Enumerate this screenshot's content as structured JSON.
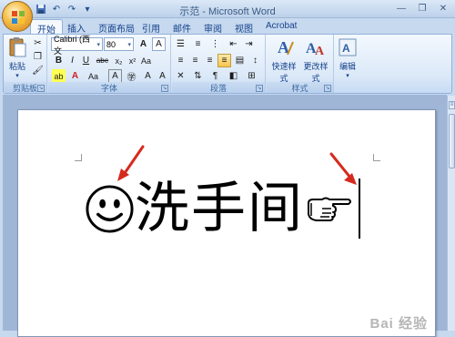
{
  "window": {
    "title": "示范 - Microsoft Word",
    "controls": [
      "minimize-icon",
      "maximize-icon",
      "close-icon"
    ]
  },
  "quick_access": [
    "save-icon",
    "undo-icon",
    "redo-icon",
    "dropdown-icon"
  ],
  "tabs": [
    {
      "label": "开始",
      "active": true
    },
    {
      "label": "插入"
    },
    {
      "label": "页面布局"
    },
    {
      "label": "引用"
    },
    {
      "label": "邮件"
    },
    {
      "label": "审阅"
    },
    {
      "label": "视图"
    },
    {
      "label": "Acrobat"
    }
  ],
  "ribbon": {
    "clipboard": {
      "label": "剪贴板",
      "paste_label": "粘贴"
    },
    "font": {
      "label": "字体",
      "font_name": "Calibri (西文",
      "font_size": "80"
    },
    "paragraph": {
      "label": "段落"
    },
    "styles": {
      "label": "样式",
      "quick_styles_label": "快速样式",
      "change_styles_label": "更改样式"
    },
    "editing": {
      "label": "编辑"
    }
  },
  "document": {
    "text": "洗手间",
    "symbols": [
      "smiley-icon",
      "pointing-hand-icon"
    ]
  },
  "watermark": "Bai 经验",
  "colors": {
    "arrow": "#d52a1e",
    "ribbon_border": "#93b1db"
  }
}
